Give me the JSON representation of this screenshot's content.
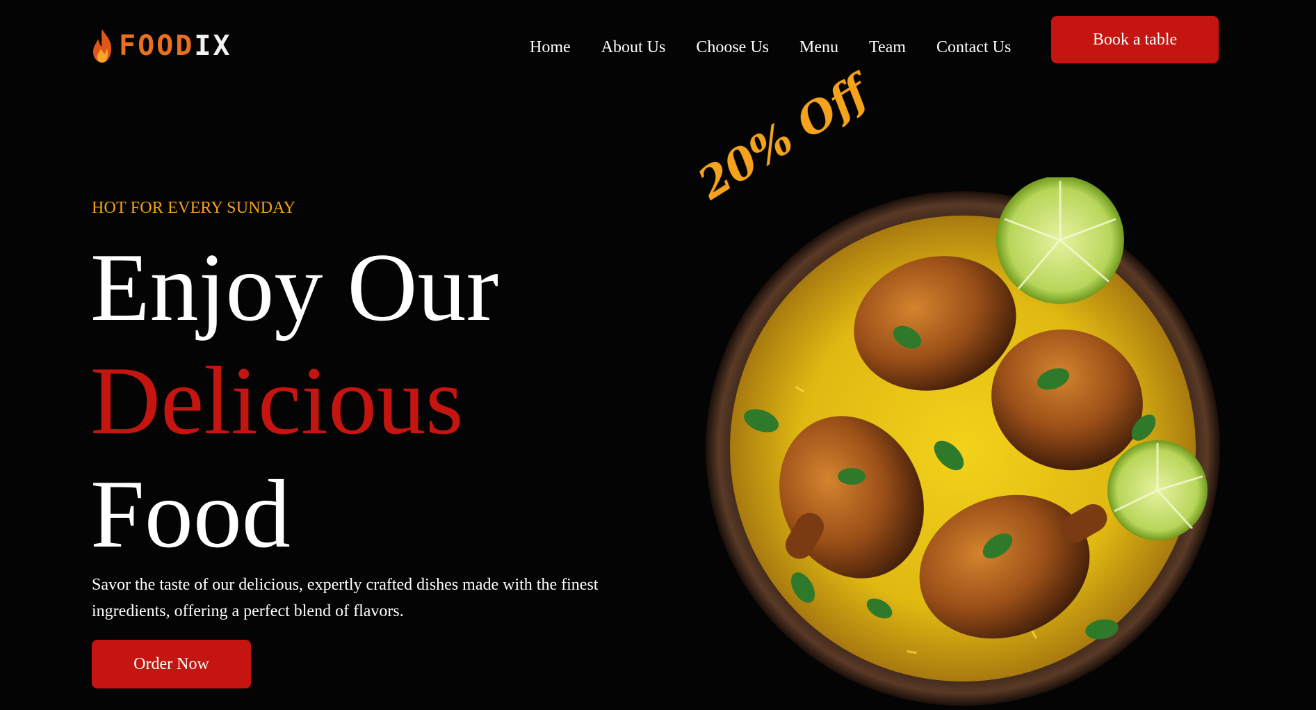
{
  "brand": {
    "name_part1": "FOOD",
    "name_part2": "IX"
  },
  "nav": {
    "items": [
      "Home",
      "About Us",
      "Choose Us",
      "Menu",
      "Team",
      "Contact Us"
    ],
    "book_label": "Book a table"
  },
  "hero": {
    "kicker": "HOT FOR EVERY SUNDAY",
    "headline_line1": "Enjoy Our",
    "headline_line2": "Delicious",
    "headline_line3": "Food",
    "description": "Savor the taste of our delicious, expertly crafted dishes made with the finest ingredients, offering a perfect blend of flavors.",
    "cta_label": "Order Now",
    "promo": "20% Off"
  },
  "colors": {
    "background": "#040404",
    "accent_red": "#c41510",
    "accent_orange": "#f5a21c",
    "logo_orange": "#e8701f"
  }
}
